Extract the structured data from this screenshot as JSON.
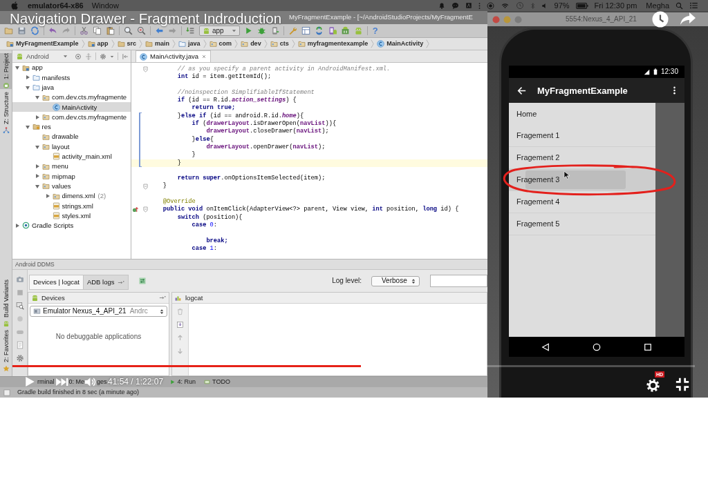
{
  "menu_bar": {
    "app_name": "emulator64-x86",
    "menus": [
      "Window"
    ],
    "battery": "97%",
    "clock": "Fri 12:30 pm",
    "user": "Megha"
  },
  "video": {
    "title": "Navigation Drawer - Fragment Indroduction",
    "time": "41:54 / 1:22:07",
    "progress": {
      "level": 0.511
    },
    "buffer": {
      "level": 0.529
    },
    "quality_badge": "HD"
  },
  "ide": {
    "window_title": "MyFragmentExample - [~/AndroidStudioProjects/MyFragmentE",
    "run_config": "app",
    "help": "?",
    "breadcrumbs": [
      {
        "label": "MyFragmentExample",
        "kind": "module"
      },
      {
        "label": "app",
        "kind": "module"
      },
      {
        "label": "src",
        "kind": "dir"
      },
      {
        "label": "main",
        "kind": "dir"
      },
      {
        "label": "java",
        "kind": "folder"
      },
      {
        "label": "com",
        "kind": "package"
      },
      {
        "label": "dev",
        "kind": "package"
      },
      {
        "label": "cts",
        "kind": "package"
      },
      {
        "label": "myfragmentexample",
        "kind": "package"
      },
      {
        "label": "MainActivity",
        "kind": "class"
      }
    ],
    "side_tabs_top": [
      {
        "label": "1: Project",
        "kind": "project",
        "selected": true
      },
      {
        "label": "Z: Structure",
        "kind": "structure",
        "selected": false
      }
    ],
    "side_tabs_bottom": [
      {
        "label": "Build Variants",
        "kind": "variants",
        "selected": false
      },
      {
        "label": "2: Favorites",
        "kind": "favorites",
        "selected": false
      }
    ],
    "project_view": "Android",
    "tree": [
      {
        "label": "app",
        "kind": "module",
        "expanded": true,
        "selected": false,
        "children": [
          {
            "label": "manifests",
            "kind": "folder",
            "expanded": false,
            "selected": false
          },
          {
            "label": "java",
            "kind": "folder",
            "expanded": true,
            "selected": false,
            "children": [
              {
                "label": "com.dev.cts.myfragmente",
                "kind": "package",
                "expanded": true,
                "selected": false,
                "children": [
                  {
                    "label": "MainActivity",
                    "kind": "class",
                    "selected": true
                  }
                ]
              },
              {
                "label": "com.dev.cts.myfragmente",
                "kind": "package",
                "expanded": false,
                "selected": false
              }
            ]
          },
          {
            "label": "res",
            "kind": "res",
            "expanded": true,
            "selected": false,
            "children": [
              {
                "label": "drawable",
                "kind": "package",
                "selected": false
              },
              {
                "label": "layout",
                "kind": "package",
                "expanded": true,
                "selected": false,
                "children": [
                  {
                    "label": "activity_main.xml",
                    "kind": "xml",
                    "selected": false
                  }
                ]
              },
              {
                "label": "menu",
                "kind": "package",
                "expanded": false,
                "selected": false
              },
              {
                "label": "mipmap",
                "kind": "package",
                "expanded": false,
                "selected": false
              },
              {
                "label": "values",
                "kind": "package",
                "expanded": true,
                "selected": false,
                "children": [
                  {
                    "label": "dimens.xml",
                    "kind": "package",
                    "expanded": false,
                    "count": "(2)",
                    "selected": false
                  },
                  {
                    "label": "strings.xml",
                    "kind": "xml",
                    "selected": false
                  },
                  {
                    "label": "styles.xml",
                    "kind": "xml",
                    "selected": false
                  }
                ]
              }
            ]
          }
        ]
      },
      {
        "label": "Gradle Scripts",
        "kind": "gradle",
        "expanded": false,
        "selected": false
      }
    ],
    "editor_tabs": [
      {
        "label": "MainActivity.java",
        "selected": true
      }
    ],
    "code": [
      {
        "kind": "code",
        "tokens": [
          {
            "text": "        // as you specify a parent activity in AndroidManifest.xml.",
            "kind": "comment"
          }
        ],
        "fold": true,
        "override": false,
        "changed": false,
        "current": false
      },
      {
        "kind": "code",
        "tokens": [
          {
            "text": "        int",
            "kind": "keyword"
          },
          {
            "text": " id = item.getItemId();",
            "kind": "plain"
          }
        ],
        "fold": false,
        "override": false,
        "changed": false,
        "current": false
      },
      {
        "kind": "blank"
      },
      {
        "kind": "code",
        "tokens": [
          {
            "text": "        //noinspection SimplifiableIfStatement",
            "kind": "comment"
          }
        ],
        "fold": false,
        "override": false,
        "changed": false,
        "current": false
      },
      {
        "kind": "code",
        "tokens": [
          {
            "text": "        if",
            "kind": "keyword"
          },
          {
            "text": " (id == R.id.",
            "kind": "plain"
          },
          {
            "text": "action_settings",
            "kind": "static_field"
          },
          {
            "text": ") {",
            "kind": "plain"
          }
        ],
        "fold": false,
        "override": false,
        "changed": false,
        "current": false
      },
      {
        "kind": "code",
        "tokens": [
          {
            "text": "            return true;",
            "kind": "keyword"
          }
        ],
        "fold": false,
        "override": false,
        "changed": false,
        "current": false
      },
      {
        "kind": "code",
        "tokens": [
          {
            "text": "        }",
            "kind": "plain"
          },
          {
            "text": "else if",
            "kind": "keyword"
          },
          {
            "text": " (id == android.R.id.",
            "kind": "plain"
          },
          {
            "text": "home",
            "kind": "static_field"
          },
          {
            "text": "){",
            "kind": "plain"
          }
        ],
        "fold": false,
        "override": false,
        "changed": true,
        "current": false
      },
      {
        "kind": "code",
        "tokens": [
          {
            "text": "            if",
            "kind": "keyword"
          },
          {
            "text": " (",
            "kind": "plain"
          },
          {
            "text": "drawerLayout",
            "kind": "field"
          },
          {
            "text": ".isDrawerOpen(",
            "kind": "plain"
          },
          {
            "text": "navList",
            "kind": "field"
          },
          {
            "text": ")){",
            "kind": "plain"
          }
        ],
        "fold": false,
        "override": false,
        "changed": true,
        "current": false
      },
      {
        "kind": "code",
        "tokens": [
          {
            "text": "                drawerLayout",
            "kind": "field"
          },
          {
            "text": ".closeDrawer(",
            "kind": "plain"
          },
          {
            "text": "navList",
            "kind": "field"
          },
          {
            "text": ");",
            "kind": "plain"
          }
        ],
        "fold": false,
        "override": false,
        "changed": true,
        "current": false
      },
      {
        "kind": "code",
        "tokens": [
          {
            "text": "            }",
            "kind": "plain"
          },
          {
            "text": "else",
            "kind": "keyword"
          },
          {
            "text": "{",
            "kind": "plain"
          }
        ],
        "fold": false,
        "override": false,
        "changed": true,
        "current": false
      },
      {
        "kind": "code",
        "tokens": [
          {
            "text": "                drawerLayout",
            "kind": "field"
          },
          {
            "text": ".openDrawer(",
            "kind": "plain"
          },
          {
            "text": "navList",
            "kind": "field"
          },
          {
            "text": ");",
            "kind": "plain"
          }
        ],
        "fold": false,
        "override": false,
        "changed": true,
        "current": false
      },
      {
        "kind": "code",
        "tokens": [
          {
            "text": "            }",
            "kind": "plain"
          }
        ],
        "fold": false,
        "override": false,
        "changed": true,
        "current": false
      },
      {
        "kind": "code",
        "tokens": [
          {
            "text": "        }",
            "kind": "plain"
          }
        ],
        "fold": false,
        "override": false,
        "changed": true,
        "current": true
      },
      {
        "kind": "blank"
      },
      {
        "kind": "code",
        "tokens": [
          {
            "text": "        return super",
            "kind": "keyword"
          },
          {
            "text": ".onOptionsItemSelected(item);",
            "kind": "plain"
          }
        ],
        "fold": false,
        "override": false,
        "changed": false,
        "current": false
      },
      {
        "kind": "code",
        "tokens": [
          {
            "text": "    }",
            "kind": "plain"
          }
        ],
        "fold": true,
        "override": false,
        "changed": false,
        "current": false
      },
      {
        "kind": "blank"
      },
      {
        "kind": "code",
        "tokens": [
          {
            "text": "    @Override",
            "kind": "annotation"
          }
        ],
        "fold": false,
        "override": false,
        "changed": false,
        "current": false
      },
      {
        "kind": "code",
        "tokens": [
          {
            "text": "    public void",
            "kind": "keyword"
          },
          {
            "text": " onItemClick(AdapterView<?> parent, View view, ",
            "kind": "plain"
          },
          {
            "text": "int",
            "kind": "keyword"
          },
          {
            "text": " position, ",
            "kind": "plain"
          },
          {
            "text": "long",
            "kind": "keyword"
          },
          {
            "text": " id) {",
            "kind": "plain"
          }
        ],
        "fold": true,
        "override": true,
        "changed": false,
        "current": false
      },
      {
        "kind": "code",
        "tokens": [
          {
            "text": "        switch",
            "kind": "keyword"
          },
          {
            "text": " (position){",
            "kind": "plain"
          }
        ],
        "fold": false,
        "override": false,
        "changed": false,
        "current": false
      },
      {
        "kind": "code",
        "tokens": [
          {
            "text": "            case",
            "kind": "keyword"
          },
          {
            "text": " 0",
            "kind": "number"
          },
          {
            "text": ":",
            "kind": "plain"
          }
        ],
        "fold": false,
        "override": false,
        "changed": false,
        "current": false
      },
      {
        "kind": "blank"
      },
      {
        "kind": "code",
        "tokens": [
          {
            "text": "                break;",
            "kind": "keyword"
          }
        ],
        "fold": false,
        "override": false,
        "changed": false,
        "current": false
      },
      {
        "kind": "code",
        "tokens": [
          {
            "text": "            case",
            "kind": "keyword"
          },
          {
            "text": " 1",
            "kind": "number"
          },
          {
            "text": ":",
            "kind": "plain"
          }
        ],
        "fold": false,
        "override": false,
        "changed": false,
        "current": false
      }
    ],
    "ddms": {
      "title": "Android DDMS",
      "tabs": [
        {
          "label": "Devices | logcat",
          "selected": true
        },
        {
          "label": "ADB logs",
          "selected": false
        }
      ],
      "log_level_label": "Log level:",
      "log_level": "Verbose",
      "devices_title": "Devices",
      "device": "Emulator Nexus_4_API_21",
      "device_detail": "Andrc",
      "empty_message": "No debuggable applications",
      "logcat_title": "logcat"
    },
    "tool_tabs": [
      {
        "label": "rminal",
        "kind": "plain"
      },
      {
        "label": "0: Me",
        "kind": "plain"
      },
      {
        "label": "ges",
        "kind": "plain"
      },
      {
        "label": "4: Run",
        "kind": "run"
      },
      {
        "label": "TODO",
        "kind": "todo"
      }
    ],
    "status": "Gradle build finished in 8 sec (a minute ago)"
  },
  "emulator": {
    "window_title": "5554:Nexus_4_API_21",
    "status_time": "12:30",
    "app_title": "MyFragmentExample",
    "drawer": [
      {
        "label": "Home",
        "selected": false
      },
      {
        "label": "Fragement 1",
        "selected": false
      },
      {
        "label": "Fragement 2",
        "selected": false
      },
      {
        "label": "Fragement 3",
        "selected": true
      },
      {
        "label": "Fragement 4",
        "selected": false
      },
      {
        "label": "Fragement 5",
        "selected": false
      }
    ]
  }
}
